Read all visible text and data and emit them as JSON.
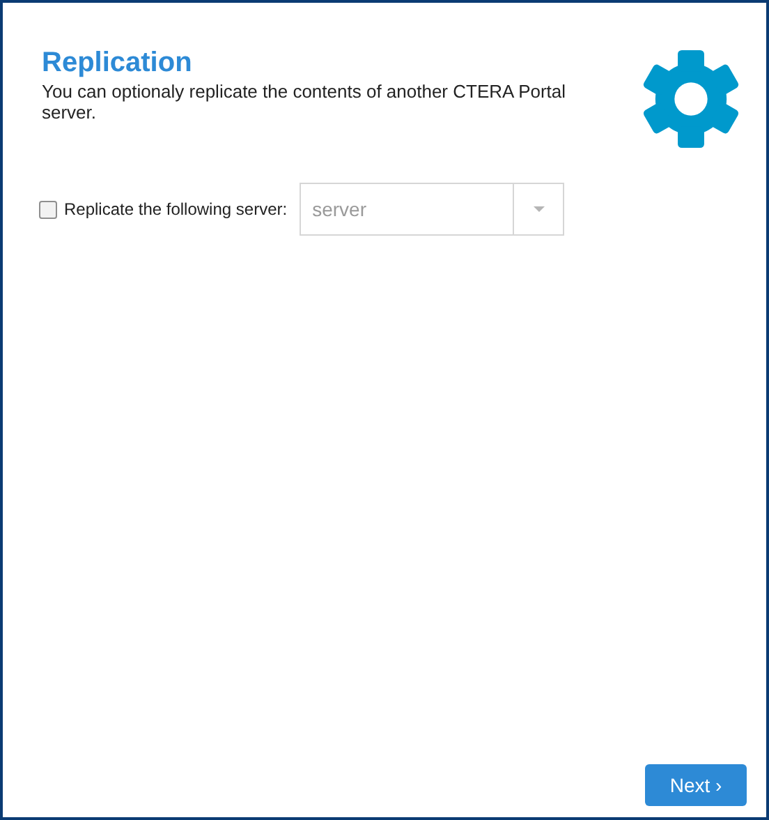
{
  "header": {
    "title": "Replication",
    "description": "You can optionaly replicate the contents of another CTERA Portal server."
  },
  "replicate": {
    "label": "Replicate the following server:",
    "checked": false
  },
  "server_select": {
    "placeholder": "server"
  },
  "buttons": {
    "next": "Next ›"
  }
}
